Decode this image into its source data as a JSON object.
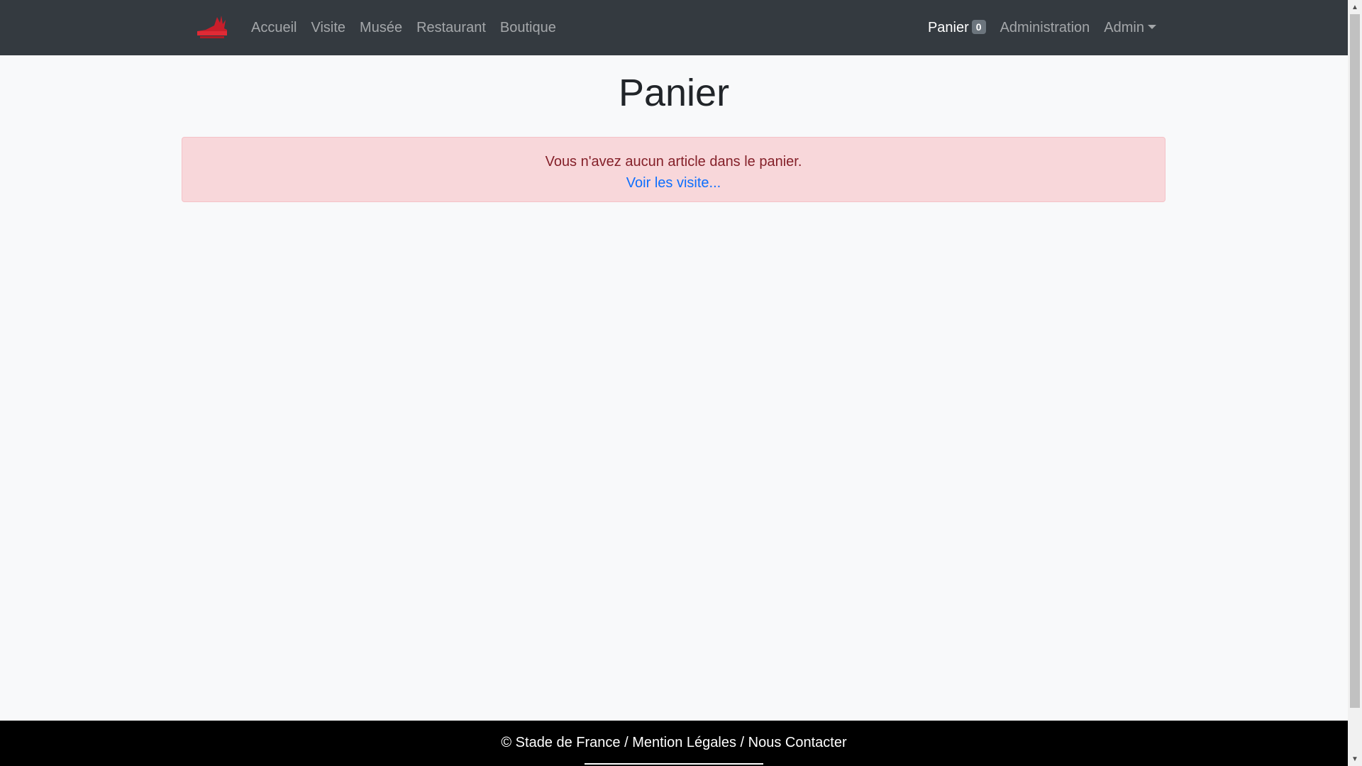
{
  "navbar": {
    "brand_icon": "stade-de-france-logo",
    "links": [
      "Accueil",
      "Visite",
      "Musée",
      "Restaurant",
      "Boutique"
    ],
    "cart_label": "Panier",
    "cart_count": "0",
    "admin_link": "Administration",
    "user_menu": "Admin"
  },
  "main": {
    "title": "Panier",
    "alert_message": "Vous n'avez aucun article dans le panier.",
    "alert_link": "Voir les visite..."
  },
  "footer": {
    "text": "© Stade de France / Mention Légales / Nous Contacter"
  },
  "colors": {
    "navbar_bg": "#343a40",
    "alert_bg": "#f8d7da",
    "alert_text": "#842029",
    "link": "#0d6efd",
    "footer_bg": "#000000",
    "logo_red": "#d21f2b"
  }
}
